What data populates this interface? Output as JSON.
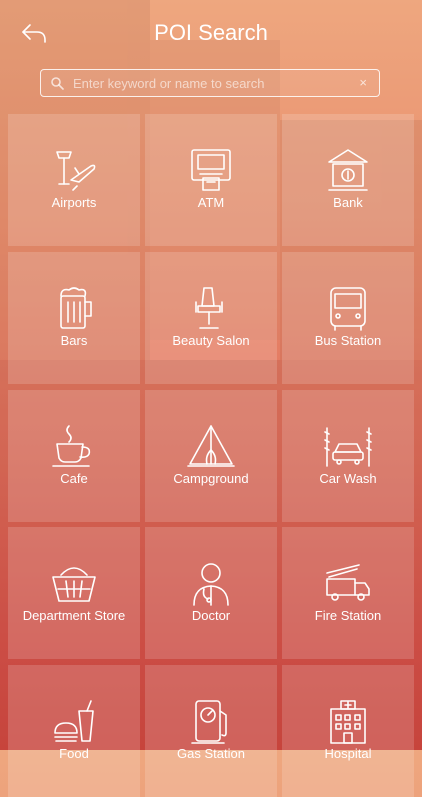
{
  "header": {
    "title": "POI Search"
  },
  "search": {
    "placeholder": "Enter keyword or name to search",
    "value": "",
    "clear_glyph": "×"
  },
  "categories": [
    {
      "label": "Airports",
      "icon": "airport-icon"
    },
    {
      "label": "ATM",
      "icon": "atm-icon"
    },
    {
      "label": "Bank",
      "icon": "bank-icon"
    },
    {
      "label": "Bars",
      "icon": "beer-icon"
    },
    {
      "label": "Beauty Salon",
      "icon": "salon-chair-icon"
    },
    {
      "label": "Bus Station",
      "icon": "bus-icon"
    },
    {
      "label": "Cafe",
      "icon": "coffee-cup-icon"
    },
    {
      "label": "Campground",
      "icon": "tent-icon"
    },
    {
      "label": "Car Wash",
      "icon": "car-wash-icon"
    },
    {
      "label": "Department Store",
      "icon": "basket-icon"
    },
    {
      "label": "Doctor",
      "icon": "doctor-icon"
    },
    {
      "label": "Fire Station",
      "icon": "fire-truck-icon"
    },
    {
      "label": "Food",
      "icon": "fast-food-icon"
    },
    {
      "label": "Gas Station",
      "icon": "gas-pump-icon"
    },
    {
      "label": "Hospital",
      "icon": "hospital-icon"
    }
  ]
}
